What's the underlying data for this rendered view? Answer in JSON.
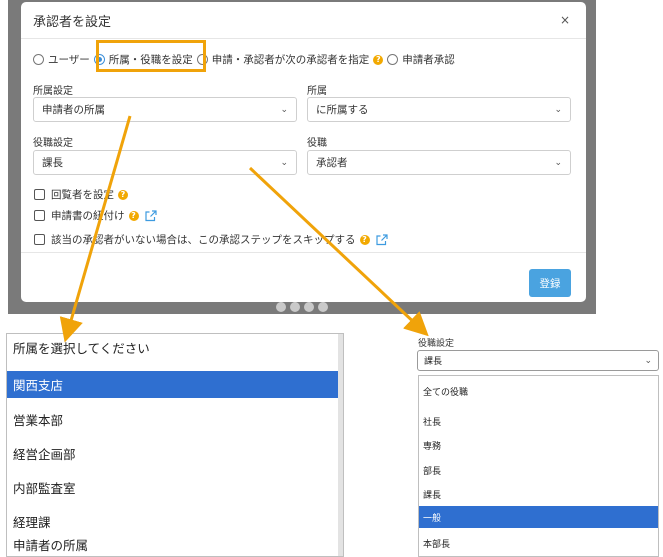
{
  "modal": {
    "title": "承認者を設定",
    "close": "×",
    "radio_options": [
      {
        "label": "ユーザー",
        "checked": false
      },
      {
        "label": "所属・役職を設定",
        "checked": true
      },
      {
        "label": "申請・承認者が次の承認者を指定",
        "checked": false
      },
      {
        "label": "申請者承認",
        "checked": false
      }
    ],
    "affiliation_setting": {
      "label": "所属設定",
      "value": "申請者の所属"
    },
    "affiliation": {
      "label": "所属",
      "value": "に所属する"
    },
    "position_setting": {
      "label": "役職設定",
      "value": "課長"
    },
    "position": {
      "label": "役職",
      "value": "承認者"
    },
    "checkboxes": [
      {
        "label": "回覧者を設定",
        "help": true,
        "link": false
      },
      {
        "label": "申請書の紐付け",
        "help": true,
        "link": true
      },
      {
        "label": "該当の承認者がいない場合は、この承認ステップをスキップする",
        "help": true,
        "link": true
      }
    ],
    "submit_label": "登録"
  },
  "affiliation_dropdown": {
    "placeholder": "所属を選択してください",
    "items": [
      "関西支店",
      "営業本部",
      "経営企画部",
      "内部監査室",
      "経理課",
      "申請者の所属"
    ],
    "selected_index": 0
  },
  "position_dropdown": {
    "label": "役職設定",
    "value": "課長",
    "items": [
      "全ての役職",
      "社長",
      "専務",
      "部長",
      "課長",
      "一般",
      "本部長"
    ],
    "selected_index": 5
  },
  "colors": {
    "accent": "#3d8fd8",
    "highlight": "#f0a30a",
    "help": "#f2a900",
    "selected": "#2f6fd0",
    "submit": "#4aa3e0"
  }
}
